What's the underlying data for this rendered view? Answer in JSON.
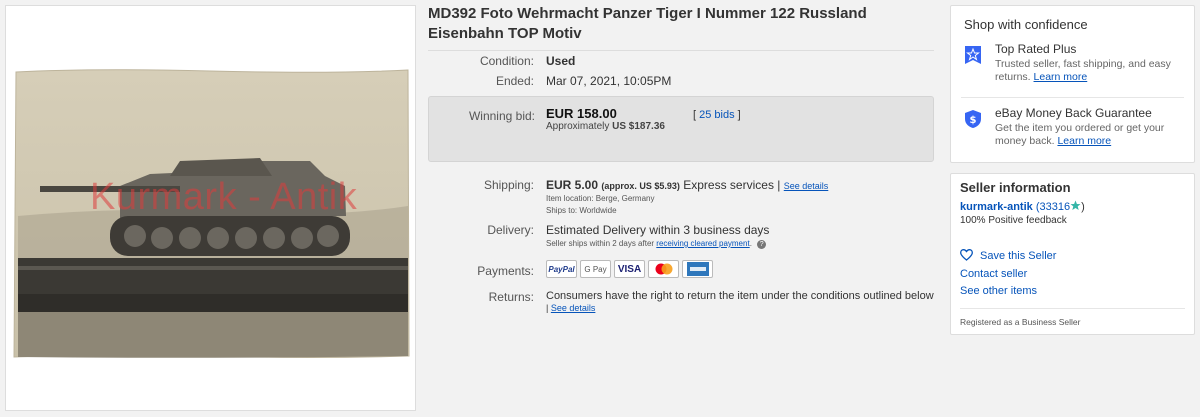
{
  "photo": {
    "watermark": "Kurmark - Antik"
  },
  "listing": {
    "title": "MD392 Foto Wehrmacht Panzer Tiger I Nummer 122 Russland Eisenbahn TOP Motiv",
    "condition_label": "Condition:",
    "condition_value": "Used",
    "ended_label": "Ended:",
    "ended_value": "Mar 07, 2021, 10:05PM",
    "winning_bid_label": "Winning bid:",
    "winning_bid_value": "EUR 158.00",
    "approx_prefix": "Approximately",
    "approx_value": "US $187.36",
    "bids_open": "[",
    "bids_link": "25 bids",
    "bids_close": "]"
  },
  "shipping": {
    "label": "Shipping:",
    "price": "EUR 5.00",
    "approx": "(approx. US $5.93)",
    "service": "Express services",
    "sep": "|",
    "see_details": "See details",
    "item_location": "Item location:  Berge, Germany",
    "ships_to": "Ships to:  Worldwide"
  },
  "delivery": {
    "label": "Delivery:",
    "value": "Estimated Delivery within 3 business days",
    "note_prefix": "Seller ships within 2 days after",
    "note_link": "receiving cleared payment",
    "note_suffix": "."
  },
  "payments": {
    "label": "Payments:",
    "methods": [
      "PayPal",
      "G Pay",
      "VISA",
      "Mastercard",
      "American Express"
    ]
  },
  "returns": {
    "label": "Returns:",
    "value": "Consumers have the right to return the item under the conditions outlined below",
    "sep": "|",
    "see_details": "See details"
  },
  "confidence": {
    "title": "Shop with confidence",
    "top_rated_title": "Top Rated Plus",
    "top_rated_desc": "Trusted seller, fast shipping, and easy returns.",
    "top_rated_link": "Learn more",
    "mbg_title": "eBay Money Back Guarantee",
    "mbg_desc": "Get the item you ordered or get your money back.",
    "mbg_link": "Learn more"
  },
  "seller": {
    "title": "Seller information",
    "name": "kurmark-antik",
    "count_open": "(33316",
    "count_close": ")",
    "feedback": "100% Positive feedback",
    "save": "Save this Seller",
    "contact": "Contact seller",
    "other_items": "See other items",
    "registered": "Registered as a Business Seller"
  },
  "colors": {
    "link": "#0654ba",
    "accent_blue": "#3665f3",
    "star_teal": "#35b6a8"
  }
}
